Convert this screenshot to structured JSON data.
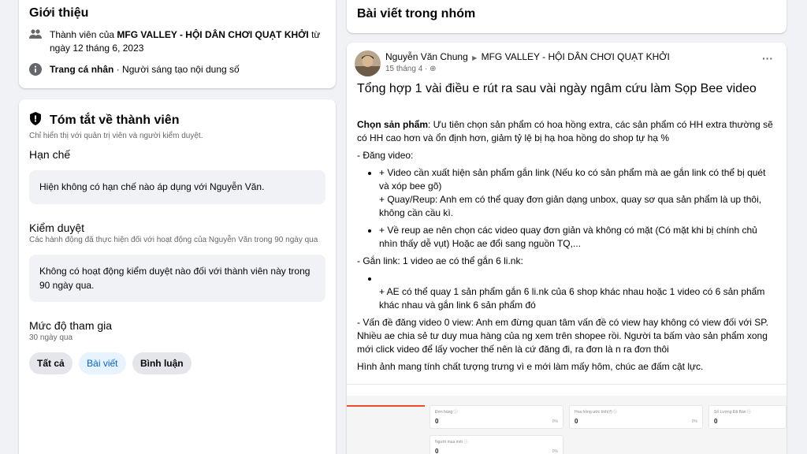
{
  "intro": {
    "title": "Giới thiệu",
    "member_prefix": "Thành viên của ",
    "group_name": "MFG VALLEY - HỘI DÂN CHƠI QUẠT KHỞI",
    "member_suffix": " từ ngày 12 tháng 6, 2023",
    "profile_strong": "Trang cá nhân",
    "profile_rest": " · Người sáng tạo nội dung số"
  },
  "summary": {
    "title": "Tóm tắt về thành viên",
    "note": "Chỉ hiển thị với quản trị viên và người kiểm duyệt.",
    "restrictions_title": "Hạn chế",
    "restrictions_text": "Hiện không có hạn chế nào áp dụng với Nguyễn Văn.",
    "moderation_title": "Kiểm duyệt",
    "moderation_note": "Các hành động đã thực hiện đối với hoạt động của Nguyễn Văn trong 90 ngày qua",
    "moderation_text": "Không có hoạt động kiểm duyệt nào đối với thành viên này trong 90 ngày qua.",
    "engagement_title": "Mức độ tham gia",
    "engagement_note": "30 ngày qua",
    "chips": [
      "Tất cả",
      "Bài viết",
      "Bình luận"
    ]
  },
  "posts_header": "Bài viết trong nhóm",
  "post": {
    "author": "Nguyễn Văn Chung",
    "group": "MFG VALLEY - HỘI DÂN CHƠI QUẠT KHỞI",
    "time": "15 tháng 4 · ",
    "more": "···",
    "title": "Tổng hợp 1 vài điều e rút ra sau vài ngày ngâm cứu làm Sọp Bee video",
    "p1_label": "Chọn sản phẩm",
    "p1_text": ": Ưu tiên chọn sản phẩm có hoa hồng extra, các sản phẩm có HH extra thường sẽ có HH cao hơn và ổn định hơn, giảm tỷ lệ bị hạ hoa hồng do shop tự hạ %",
    "p2": "- Đăng video:",
    "b1": "+ Video cần xuất hiện sản phẩm gắn link (Nếu ko có sản phẩm mà ae gắn link có thể bị quét và xóp bee gõ)",
    "b1b": "+ Quay/Reup: Anh em có thể quay đơn giản dạng unbox, quay sơ qua sản phẩm là up thôi, không cần cầu kì.",
    "b2": "+ Về reup ae nên chọn các video quay đơn giản và không có mặt (Có mặt khi bị chính chủ nhìn thấy dễ vụt) Hoặc ae đổi sang nguồn TQ,...",
    "p3": "- Gắn link: 1 video ae có thể gắn 6 li.nk:",
    "b3": "+ AE có thể quay 1 sản phẩm gắn 6 li.nk của 6 shop khác nhau hoặc 1 video có 6 sản phẩm khác nhau và gắn link 6 sản phẩm đó",
    "p4": "- Vấn đề đăng video 0 view: Anh em đừng quan tâm vấn đề có view hay không có view đối với SP. Nhiều ae chia sẻ tư duy mua hàng của ng xem trên shopee rồi. Người ta bấm vào sản phẩm xong mới click video để lấy vocher thế nên là cứ đăng đi, ra đơn là n ra đơn thôi",
    "p5": "Hình ảnh mang tính chất tượng trưng vì e mới làm mấy hôm, chúc ae đấm cật lực."
  },
  "dashboard": {
    "cells": [
      {
        "label": "Đơn hàng ⓘ",
        "value": "0",
        "pct": "0%"
      },
      {
        "label": "Hoa hồng ước tính(₫) ⓘ",
        "value": "0",
        "pct": "0%"
      },
      {
        "label": "Số Lượng Đã Bán ⓘ",
        "value": "0",
        "pct": ""
      },
      {
        "label": "Người mua mới ⓘ",
        "value": "0",
        "pct": "0%"
      }
    ]
  }
}
